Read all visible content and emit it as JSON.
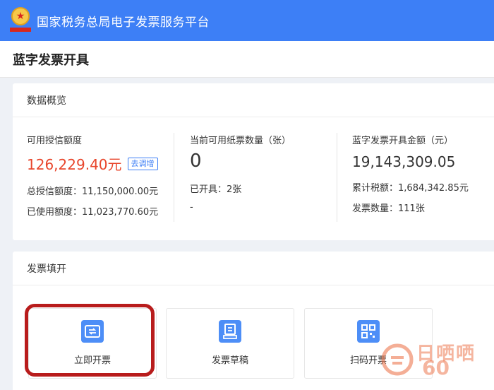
{
  "header": {
    "title": "国家税务总局电子发票服务平台"
  },
  "page": {
    "title": "蓝字发票开具"
  },
  "overview": {
    "section_title": "数据概览",
    "credit": {
      "label": "可用授信额度",
      "value": "126,229.40元",
      "tag": "去调增",
      "total_label": "总授信额度：",
      "total_value": "11,150,000.00元",
      "used_label": "已使用额度：",
      "used_value": "11,023,770.60元"
    },
    "paper": {
      "label": "当前可用纸票数量（张）",
      "value": "0",
      "issued_label": "已开具：",
      "issued_value": "2张",
      "dash": "-"
    },
    "amount": {
      "label": "蓝字发票开具金额（元）",
      "value": "19,143,309.05",
      "tax_label": "累计税额：",
      "tax_value": "1,684,342.85元",
      "count_label": "发票数量：",
      "count_value": "111张"
    }
  },
  "issue": {
    "section_title": "发票填开",
    "tiles": [
      {
        "label": "立即开票",
        "icon": "invoice-issue-icon"
      },
      {
        "label": "发票草稿",
        "icon": "invoice-draft-icon"
      },
      {
        "label": "扫码开票",
        "icon": "qr-code-icon"
      }
    ]
  },
  "watermark": {
    "text": "日哂哂",
    "number": "60"
  },
  "colors": {
    "brand_blue": "#3d7ff6",
    "amount_red": "#e8462c",
    "highlight_red": "#b81c1c"
  }
}
